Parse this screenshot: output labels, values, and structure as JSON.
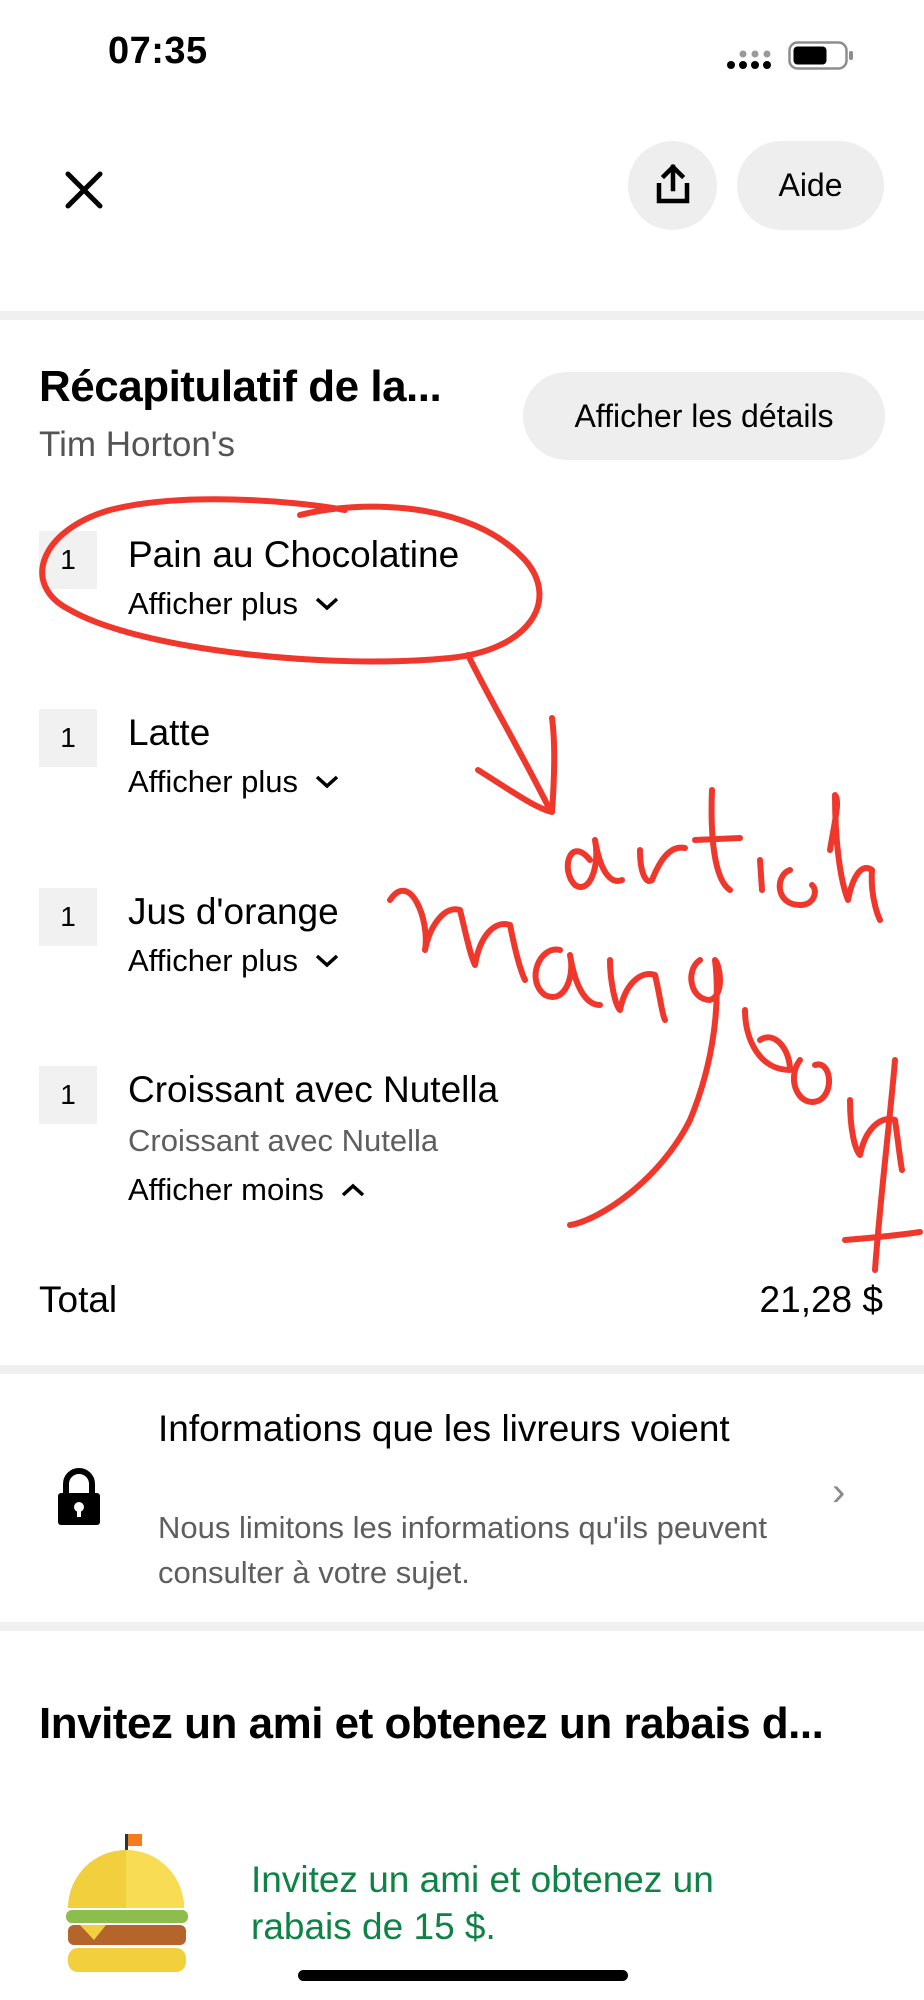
{
  "status_bar": {
    "time": "07:35"
  },
  "header": {
    "help_label": "Aide"
  },
  "summary": {
    "title": "Récapitulatif de la...",
    "store": "Tim Horton's",
    "details_button": "Afficher les détails",
    "items": [
      {
        "qty": "1",
        "name": "Pain au Chocolatine",
        "toggle": "Afficher plus"
      },
      {
        "qty": "1",
        "name": "Latte",
        "toggle": "Afficher plus"
      },
      {
        "qty": "1",
        "name": "Jus d'orange",
        "toggle": "Afficher plus"
      },
      {
        "qty": "1",
        "name": "Croissant avec Nutella",
        "description": "Croissant avec Nutella",
        "toggle": "Afficher moins"
      }
    ],
    "total_label": "Total",
    "total_value": "21,28 $"
  },
  "courier_info": {
    "title": "Informations que les livreurs voient",
    "description": "Nous limitons les informations qu'ils peuvent consulter à votre sujet."
  },
  "invite": {
    "heading": "Invitez un ami et obtenez un rabais d...",
    "text": "Invitez un ami et obtenez un rabais de 15 $."
  },
  "annotation": {
    "handwritten_text": "artich manquent",
    "color": "#f0372c"
  },
  "colors": {
    "accent_green": "#0e8345",
    "pill_bg": "#eeeeee"
  }
}
